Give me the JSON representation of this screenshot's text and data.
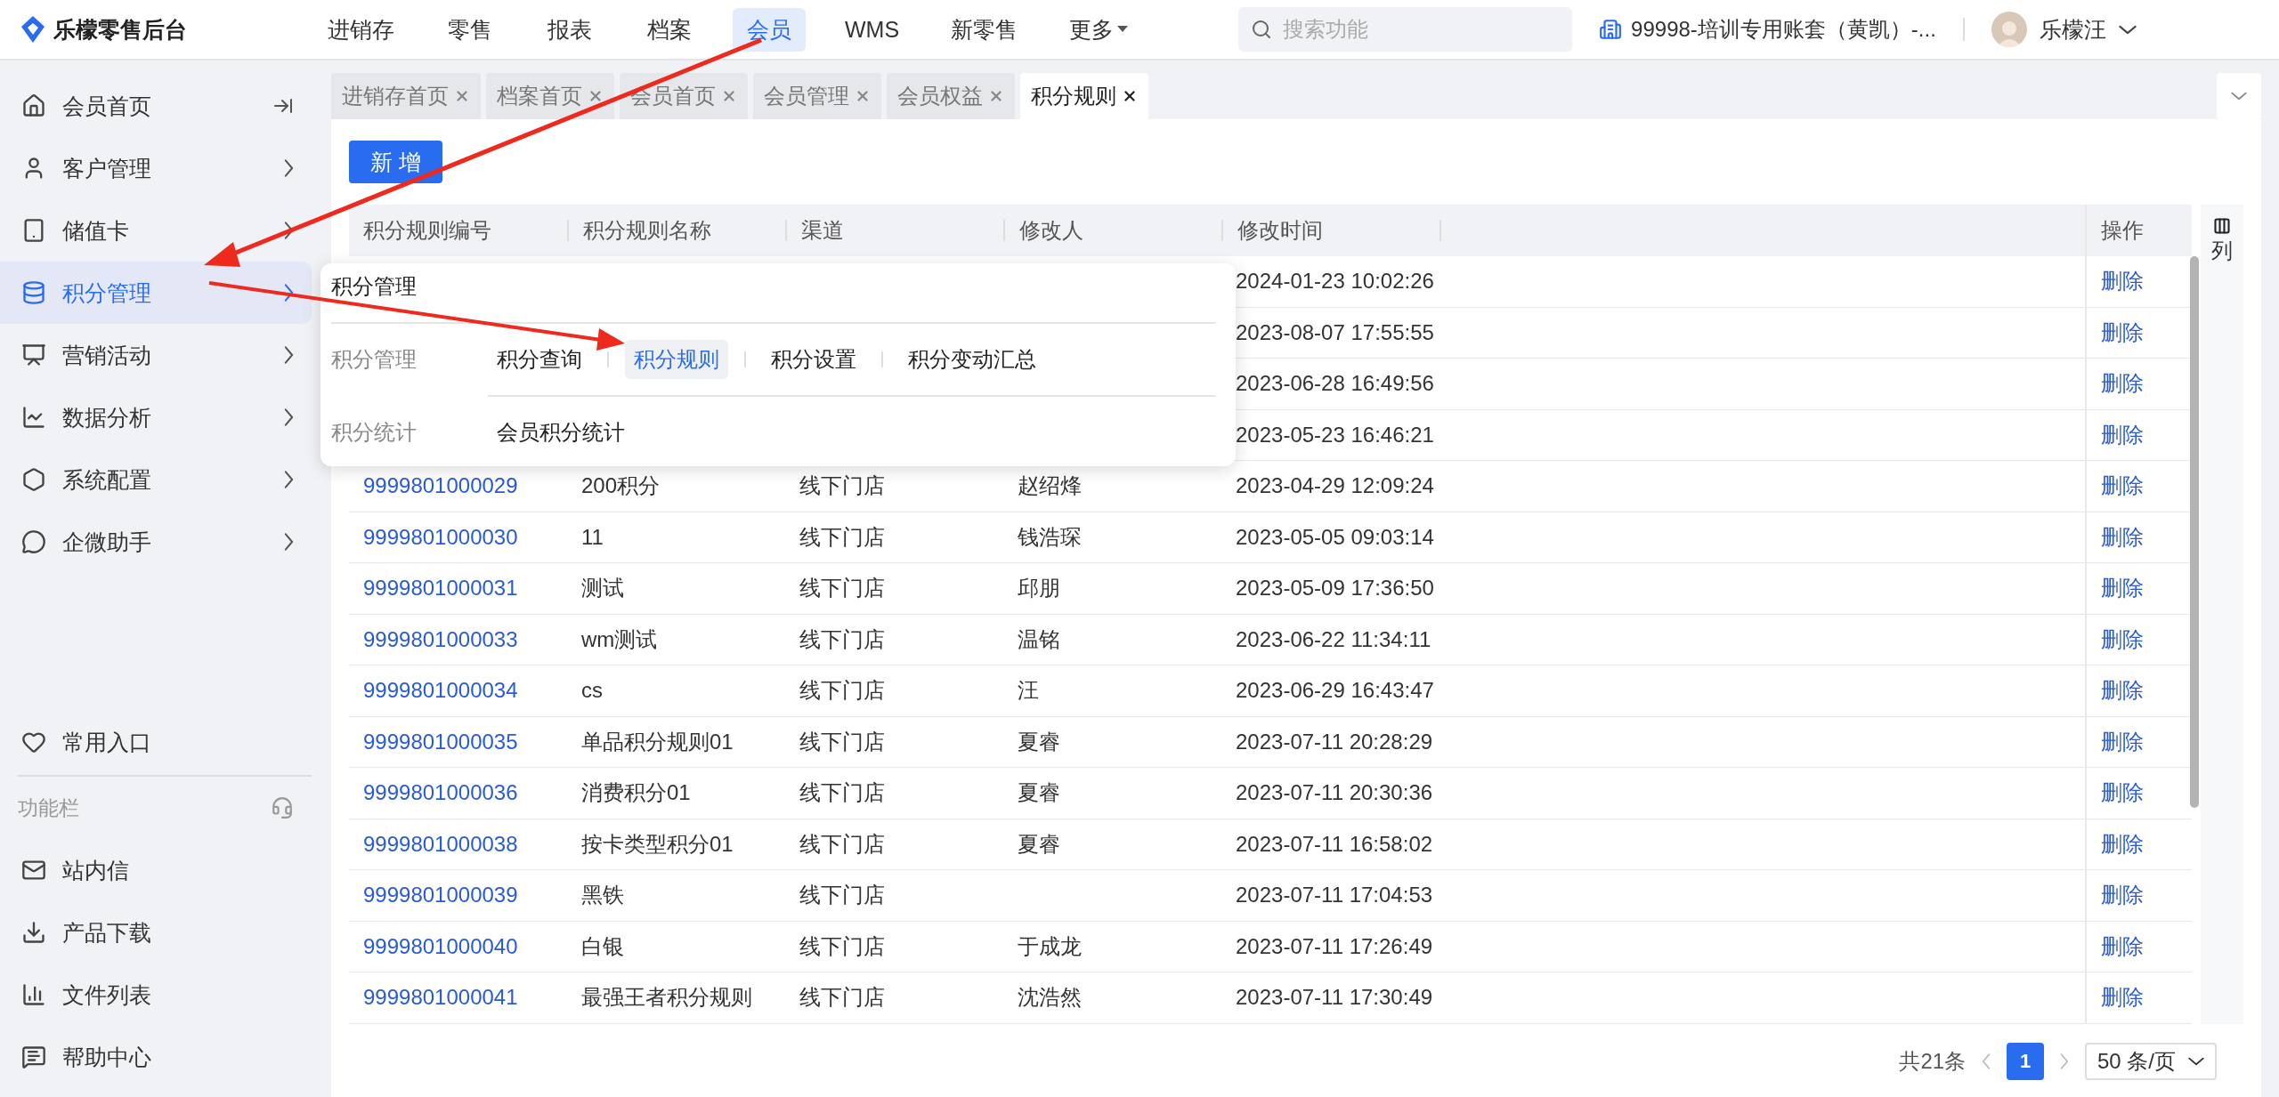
{
  "brand": {
    "name": "乐檬零售后台"
  },
  "nav": [
    {
      "label": "进销存",
      "selected": false
    },
    {
      "label": "零售",
      "selected": false
    },
    {
      "label": "报表",
      "selected": false
    },
    {
      "label": "档案",
      "selected": false
    },
    {
      "label": "会员",
      "selected": true
    },
    {
      "label": "WMS",
      "selected": false
    },
    {
      "label": "新零售",
      "selected": false
    },
    {
      "label": "更多",
      "selected": false,
      "dropdown": true
    }
  ],
  "search": {
    "placeholder": "搜索功能"
  },
  "account": {
    "label": "99998-培训专用账套（黄凯）-..."
  },
  "user": {
    "name": "乐檬汪"
  },
  "sidebar": {
    "items": [
      {
        "label": "会员首页",
        "selected": false,
        "submenu": false
      },
      {
        "label": "客户管理",
        "selected": false,
        "submenu": true
      },
      {
        "label": "储值卡",
        "selected": false,
        "submenu": true
      },
      {
        "label": "积分管理",
        "selected": true,
        "submenu": true
      },
      {
        "label": "营销活动",
        "selected": false,
        "submenu": true
      },
      {
        "label": "数据分析",
        "selected": false,
        "submenu": true
      },
      {
        "label": "系统配置",
        "selected": false,
        "submenu": true
      },
      {
        "label": "企微助手",
        "selected": false,
        "submenu": true
      }
    ],
    "favorites": {
      "label": "常用入口"
    },
    "toolbar_title": "功能栏",
    "tools": [
      {
        "label": "站内信"
      },
      {
        "label": "产品下载"
      },
      {
        "label": "文件列表"
      },
      {
        "label": "帮助中心"
      }
    ]
  },
  "tabs": [
    {
      "label": "进销存首页",
      "selected": false
    },
    {
      "label": "档案首页",
      "selected": false
    },
    {
      "label": "会员首页",
      "selected": false
    },
    {
      "label": "会员管理",
      "selected": false
    },
    {
      "label": "会员权益",
      "selected": false
    },
    {
      "label": "积分规则",
      "selected": true
    }
  ],
  "add_button": "新 增",
  "table": {
    "columns": [
      "积分规则编号",
      "积分规则名称",
      "渠道",
      "修改人",
      "修改时间"
    ],
    "action_column": "操作",
    "rows": [
      {
        "time": "2024-01-23 10:02:26",
        "action": "删除"
      },
      {
        "time": "2023-08-07 17:55:55",
        "action": "删除"
      },
      {
        "time": "2023-06-28 16:49:56",
        "action": "删除"
      },
      {
        "time": "2023-05-23 16:46:21",
        "action": "删除"
      },
      {
        "id": "9999801000029",
        "name": "200积分",
        "channel": "线下门店",
        "modifier": "赵绍烽",
        "time": "2023-04-29 12:09:24",
        "action": "删除"
      },
      {
        "id": "9999801000030",
        "name": "11",
        "channel": "线下门店",
        "modifier": "钱浩琛",
        "time": "2023-05-05 09:03:14",
        "action": "删除"
      },
      {
        "id": "9999801000031",
        "name": "测试",
        "channel": "线下门店",
        "modifier": "邱朋",
        "time": "2023-05-09 17:36:50",
        "action": "删除"
      },
      {
        "id": "9999801000033",
        "name": "wm测试",
        "channel": "线下门店",
        "modifier": "温铭",
        "time": "2023-06-22 11:34:11",
        "action": "删除"
      },
      {
        "id": "9999801000034",
        "name": "cs",
        "channel": "线下门店",
        "modifier": "汪",
        "time": "2023-06-29 16:43:47",
        "action": "删除"
      },
      {
        "id": "9999801000035",
        "name": "单品积分规则01",
        "channel": "线下门店",
        "modifier": "夏睿",
        "time": "2023-07-11 20:28:29",
        "action": "删除"
      },
      {
        "id": "9999801000036",
        "name": "消费积分01",
        "channel": "线下门店",
        "modifier": "夏睿",
        "time": "2023-07-11 20:30:36",
        "action": "删除"
      },
      {
        "id": "9999801000038",
        "name": "按卡类型积分01",
        "channel": "线下门店",
        "modifier": "夏睿",
        "time": "2023-07-11 16:58:02",
        "action": "删除"
      },
      {
        "id": "9999801000039",
        "name": "黑铁",
        "channel": "线下门店",
        "time": "2023-07-11 17:04:53",
        "action": "删除"
      },
      {
        "id": "9999801000040",
        "name": "白银",
        "channel": "线下门店",
        "modifier": "于成龙",
        "time": "2023-07-11 17:26:49",
        "action": "删除"
      },
      {
        "id": "9999801000041",
        "name": "最强王者积分规则",
        "channel": "线下门店",
        "modifier": "沈浩然",
        "time": "2023-07-11 17:30:49",
        "action": "删除"
      }
    ],
    "column_settings": "列"
  },
  "pagination": {
    "total": "共21条",
    "pages": [
      {
        "label": "1",
        "selected": true
      }
    ],
    "page_size": "50 条/页"
  },
  "popup": {
    "title": "积分管理",
    "groups": [
      {
        "label": "积分管理",
        "links": [
          {
            "label": "积分查询",
            "selected": false
          },
          {
            "label": "积分规则",
            "selected": true
          },
          {
            "label": "积分设置",
            "selected": false
          },
          {
            "label": "积分变动汇总",
            "selected": false
          }
        ]
      },
      {
        "label": "积分统计",
        "links": [
          {
            "label": "会员积分统计",
            "selected": false
          }
        ]
      }
    ]
  }
}
